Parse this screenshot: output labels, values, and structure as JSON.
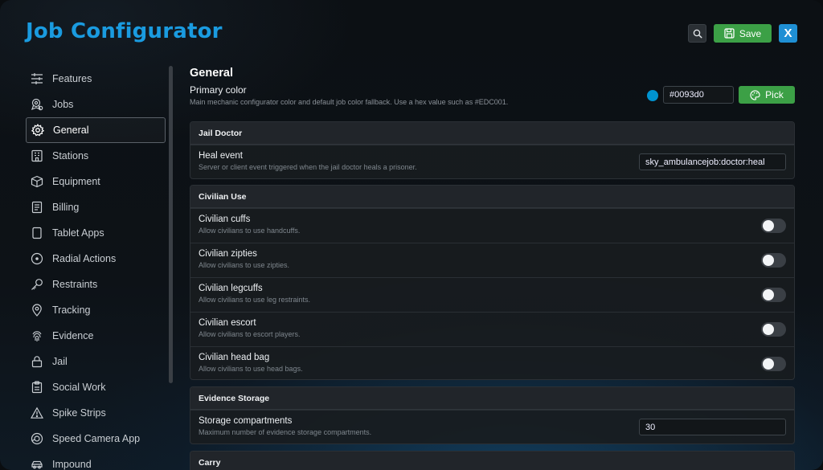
{
  "header": {
    "title": "Job Configurator",
    "save_label": "Save",
    "close_label": "X"
  },
  "sidebar": {
    "items": [
      {
        "label": "Features",
        "icon": "sliders-icon"
      },
      {
        "label": "Jobs",
        "icon": "badge-icon"
      },
      {
        "label": "General",
        "icon": "gear-icon",
        "active": true
      },
      {
        "label": "Stations",
        "icon": "building-icon"
      },
      {
        "label": "Equipment",
        "icon": "box-icon"
      },
      {
        "label": "Billing",
        "icon": "receipt-icon"
      },
      {
        "label": "Tablet Apps",
        "icon": "tablet-icon"
      },
      {
        "label": "Radial Actions",
        "icon": "radial-icon"
      },
      {
        "label": "Restraints",
        "icon": "key-icon"
      },
      {
        "label": "Tracking",
        "icon": "map-pin-icon"
      },
      {
        "label": "Evidence",
        "icon": "fingerprint-icon"
      },
      {
        "label": "Jail",
        "icon": "lock-icon"
      },
      {
        "label": "Social Work",
        "icon": "clipboard-icon"
      },
      {
        "label": "Spike Strips",
        "icon": "warning-icon"
      },
      {
        "label": "Speed Camera App",
        "icon": "camera-icon"
      },
      {
        "label": "Impound",
        "icon": "car-icon"
      }
    ]
  },
  "main": {
    "heading": "General",
    "primary_color": {
      "label": "Primary color",
      "description": "Main mechanic configurator color and default job color fallback. Use a hex value such as #EDC001.",
      "value": "#0093d0",
      "swatch_color": "#0093d0",
      "pick_label": "Pick"
    },
    "jail_doctor": {
      "title": "Jail Doctor",
      "heal_event": {
        "label": "Heal event",
        "description": "Server or client event triggered when the jail doctor heals a prisoner.",
        "value": "sky_ambulancejob:doctor:heal"
      }
    },
    "civilian_use": {
      "title": "Civilian Use",
      "rows": [
        {
          "label": "Civilian cuffs",
          "description": "Allow civilians to use handcuffs.",
          "enabled": false
        },
        {
          "label": "Civilian zipties",
          "description": "Allow civilians to use zipties.",
          "enabled": false
        },
        {
          "label": "Civilian legcuffs",
          "description": "Allow civilians to use leg restraints.",
          "enabled": false
        },
        {
          "label": "Civilian escort",
          "description": "Allow civilians to escort players.",
          "enabled": false
        },
        {
          "label": "Civilian head bag",
          "description": "Allow civilians to use head bags.",
          "enabled": false
        }
      ]
    },
    "evidence_storage": {
      "title": "Evidence Storage",
      "compartments": {
        "label": "Storage compartments",
        "description": "Maximum number of evidence storage compartments.",
        "value": "30"
      }
    },
    "carry": {
      "title": "Carry"
    }
  },
  "colors": {
    "accent": "#1a9be0",
    "save_green": "#3ca046",
    "close_blue": "#1f8fd4"
  }
}
